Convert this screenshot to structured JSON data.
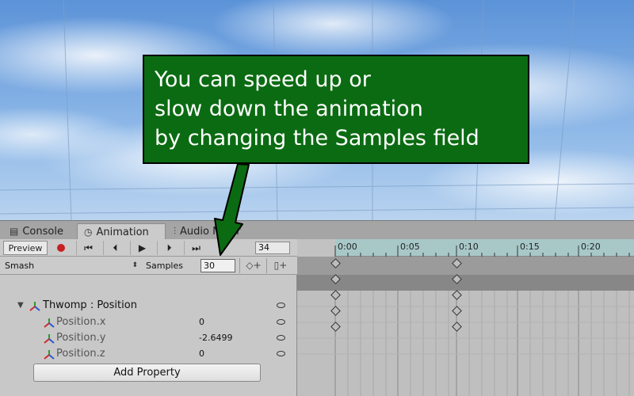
{
  "callout": {
    "line1": "You can speed up or",
    "line2": "slow down the animation",
    "line3": "by changing the Samples field"
  },
  "tabs": [
    {
      "label": "Console",
      "icon": "console-icon"
    },
    {
      "label": "Animation",
      "icon": "clock-icon"
    },
    {
      "label": "Audio Mixer",
      "icon": "mixer-icon"
    }
  ],
  "toolbar": {
    "preview_label": "Preview",
    "frame_value": "34",
    "clip_name": "Smash",
    "samples_label": "Samples",
    "samples_value": "30"
  },
  "ruler": {
    "labels": [
      "0:00",
      "0:05",
      "0:10",
      "0:15",
      "0:20"
    ]
  },
  "properties": {
    "object": "Thwomp : Position",
    "rows": [
      {
        "name": "Position.x",
        "value": "0"
      },
      {
        "name": "Position.y",
        "value": "-2.6499"
      },
      {
        "name": "Position.z",
        "value": "0"
      }
    ],
    "add_property_label": "Add Property"
  },
  "colors": {
    "callout_bg": "#0b6b12",
    "arrow": "#0b6b12",
    "record": "#c62020"
  }
}
